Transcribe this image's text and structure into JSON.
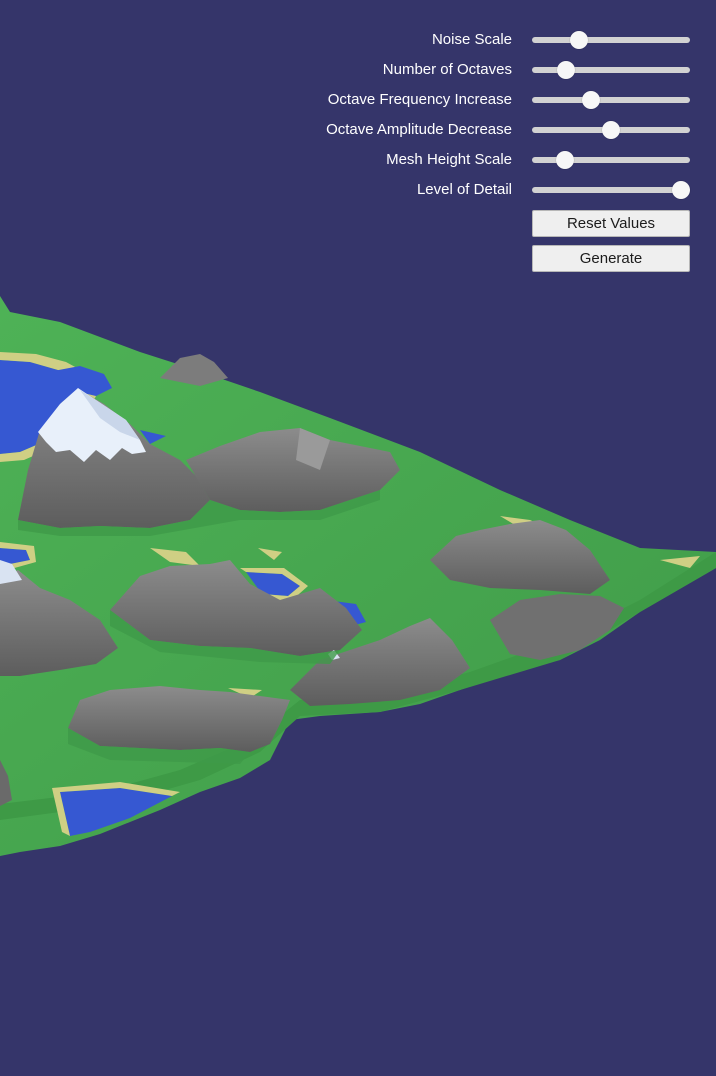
{
  "sliders": [
    {
      "label": "Noise Scale",
      "value": 0.27
    },
    {
      "label": "Number of Octaves",
      "value": 0.18
    },
    {
      "label": "Octave Frequency Increase",
      "value": 0.36
    },
    {
      "label": "Octave Amplitude Decrease",
      "value": 0.5
    },
    {
      "label": "Mesh Height Scale",
      "value": 0.17
    },
    {
      "label": "Level of Detail",
      "value": 1.0
    }
  ],
  "buttons": {
    "reset_label": "Reset Values",
    "generate_label": "Generate"
  },
  "colors": {
    "background": "#35356a",
    "grass": "#45a84e",
    "sand": "#cfcf84",
    "water": "#3658d2",
    "rock": "#7b7b7b",
    "snow": "#e8f0fa"
  }
}
